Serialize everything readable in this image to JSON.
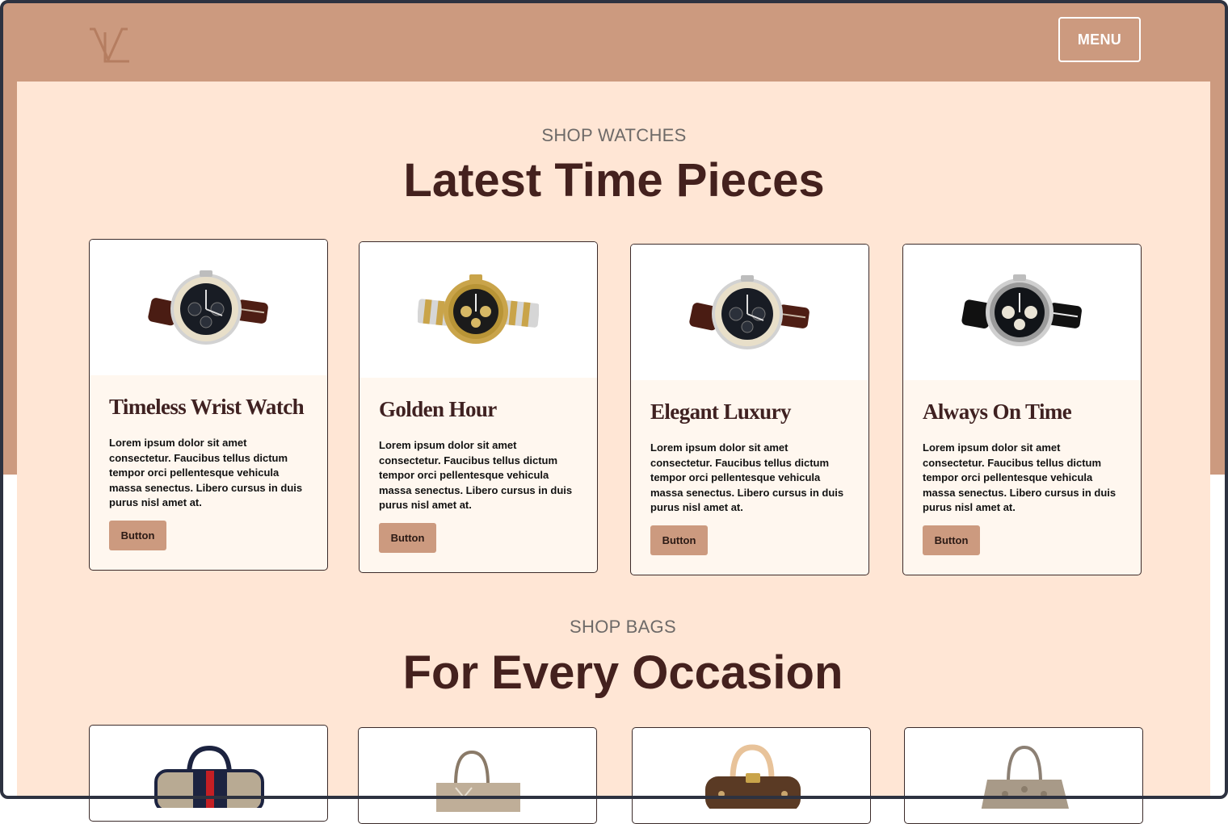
{
  "colors": {
    "brand_band": "#cc9a7f",
    "content_bg": "#ffe6d5",
    "card_bg": "#fff7ef",
    "headline": "#44211e",
    "button_bg": "#cc9a7f"
  },
  "header": {
    "logo_icon": "vl-monogram-logo",
    "menu_label": "MENU"
  },
  "watches": {
    "eyebrow": "SHOP WATCHES",
    "headline": "Latest Time Pieces",
    "cards": [
      {
        "title": "Timeless Wrist Watch",
        "text": "Lorem ipsum dolor sit amet consectetur. Faucibus tellus dictum tempor orci pellentesque vehicula massa senectus. Libero cursus in duis purus nisl amet at.",
        "button": "Button",
        "image": "brown-strap-chronograph-watch"
      },
      {
        "title": "Golden Hour",
        "text": "Lorem ipsum dolor sit amet consectetur. Faucibus tellus dictum tempor orci pellentesque vehicula massa senectus. Libero cursus in duis purus nisl amet at.",
        "button": "Button",
        "image": "two-tone-steel-gold-watch"
      },
      {
        "title": "Elegant Luxury",
        "text": "Lorem ipsum dolor sit amet consectetur. Faucibus tellus dictum tempor orci pellentesque vehicula massa senectus. Libero cursus in duis purus nisl amet at.",
        "button": "Button",
        "image": "brown-strap-chronograph-watch"
      },
      {
        "title": "Always On Time",
        "text": "Lorem ipsum dolor sit amet consectetur. Faucibus tellus dictum tempor orci pellentesque vehicula massa senectus. Libero cursus in duis purus nisl amet at.",
        "button": "Button",
        "image": "black-strap-chronograph-watch"
      }
    ]
  },
  "bags": {
    "eyebrow": "SHOP BAGS",
    "headline": "For Every Occasion",
    "cards": [
      {
        "image": "monogram-duffle-bag-red-stripe"
      },
      {
        "image": "beige-tote-bag"
      },
      {
        "image": "brown-monogram-speedy-bag"
      },
      {
        "image": "taupe-monogram-tote-bag"
      }
    ]
  }
}
